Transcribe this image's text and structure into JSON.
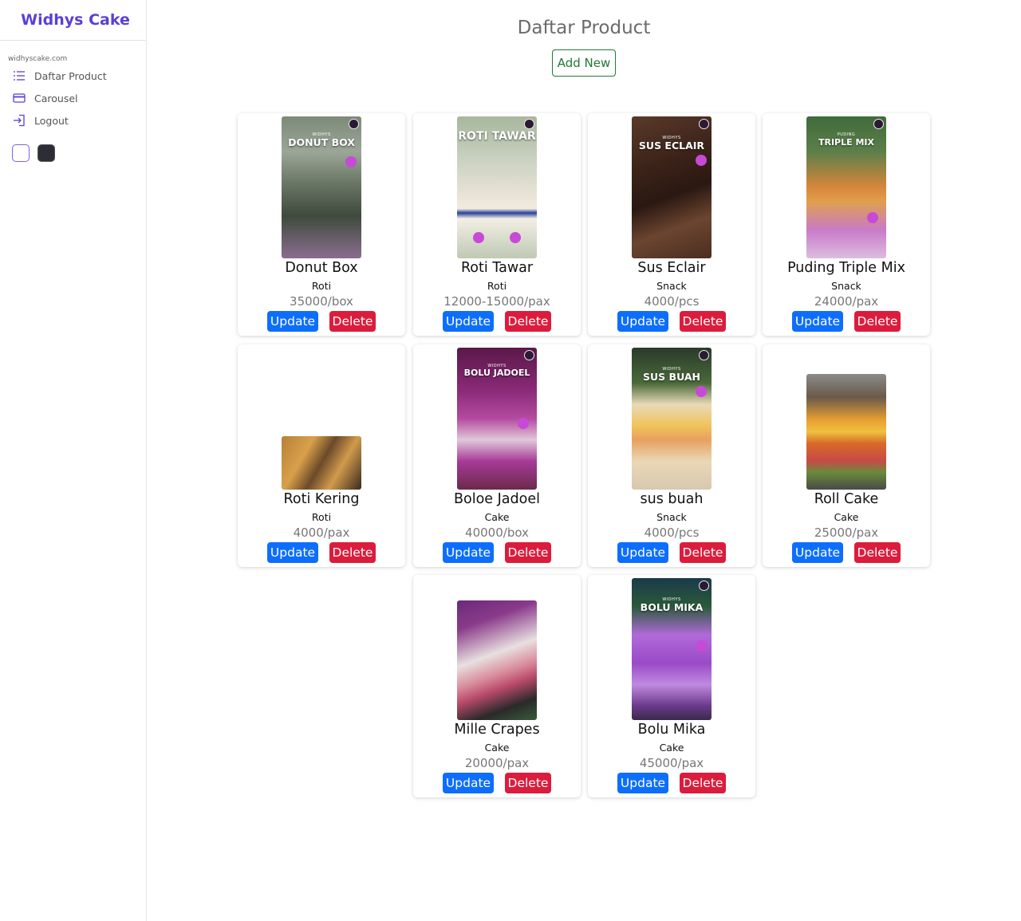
{
  "sidebar": {
    "brand": "Widhys Cake",
    "domain": "widhyscake.com",
    "items": [
      {
        "label": "Daftar Product",
        "icon": "list-icon"
      },
      {
        "label": "Carousel",
        "icon": "credit-card-icon"
      },
      {
        "label": "Logout",
        "icon": "logout-icon"
      }
    ],
    "themes": [
      "light",
      "dark"
    ]
  },
  "main": {
    "title": "Daftar Product",
    "add_label": "Add New"
  },
  "colors": {
    "brand": "#5b3fd6",
    "update": "#0d6efd",
    "delete": "#dc1c3c",
    "add": "#1f7a33"
  },
  "products": [
    {
      "name": "Donut Box",
      "category": "Roti",
      "price": "35000/box",
      "update_label": "Update",
      "delete_label": "Delete",
      "image_text": "DONUT BOX",
      "image_small": "WIDHYS"
    },
    {
      "name": "Roti Tawar",
      "category": "Roti",
      "price": "12000-15000/pax",
      "update_label": "Update",
      "delete_label": "Delete",
      "image_text": "ROTI TAWAR",
      "image_small": ""
    },
    {
      "name": "Sus Eclair",
      "category": "Snack",
      "price": "4000/pcs",
      "update_label": "Update",
      "delete_label": "Delete",
      "image_text": "SUS ECLAIR",
      "image_small": "WIDHYS"
    },
    {
      "name": "Puding Triple Mix",
      "category": "Snack",
      "price": "24000/pax",
      "update_label": "Update",
      "delete_label": "Delete",
      "image_text": "TRIPLE MIX",
      "image_small": "PUDING"
    },
    {
      "name": "Roti Kering",
      "category": "Roti",
      "price": "4000/pax",
      "update_label": "Update",
      "delete_label": "Delete",
      "image_text": "",
      "image_small": ""
    },
    {
      "name": "Boloe Jadoel",
      "category": "Cake",
      "price": "40000/box",
      "update_label": "Update",
      "delete_label": "Delete",
      "image_text": "BOLU JADOEL",
      "image_small": "WIDHYS"
    },
    {
      "name": "sus buah",
      "category": "Snack",
      "price": "4000/pcs",
      "update_label": "Update",
      "delete_label": "Delete",
      "image_text": "SUS BUAH",
      "image_small": "WIDHYS"
    },
    {
      "name": "Roll Cake",
      "category": "Cake",
      "price": "25000/pax",
      "update_label": "Update",
      "delete_label": "Delete",
      "image_text": "",
      "image_small": ""
    },
    {
      "name": "Mille Crapes",
      "category": "Cake",
      "price": "20000/pax",
      "update_label": "Update",
      "delete_label": "Delete",
      "image_text": "",
      "image_small": ""
    },
    {
      "name": "Bolu Mika",
      "category": "Cake",
      "price": "45000/pax",
      "update_label": "Update",
      "delete_label": "Delete",
      "image_text": "BOLU MIKA",
      "image_small": "WIDHYS"
    }
  ]
}
